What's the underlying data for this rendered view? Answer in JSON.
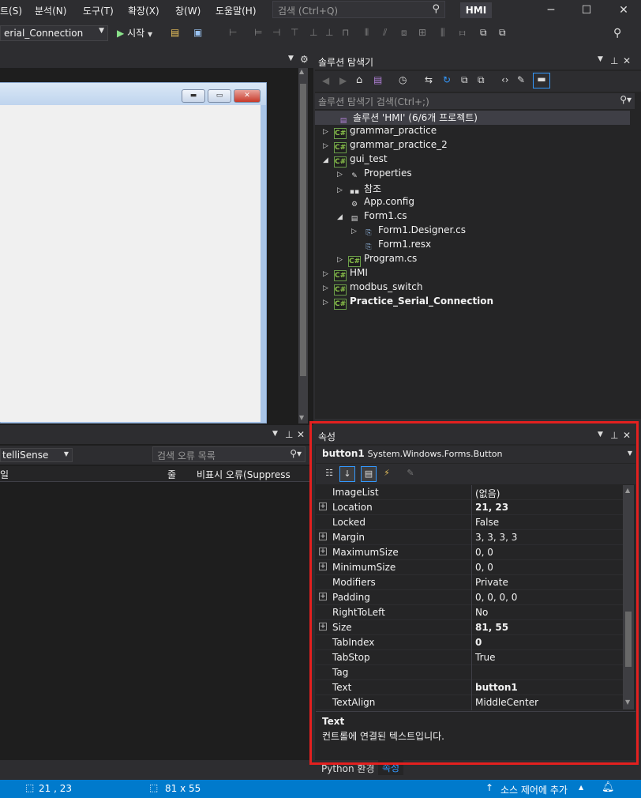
{
  "menubar": {
    "items": [
      "트(S)",
      "분석(N)",
      "도구(T)",
      "확장(X)",
      "창(W)",
      "도움말(H)"
    ],
    "search_placeholder": "검색 (Ctrl+Q)",
    "solution_name": "HMI"
  },
  "toolbar": {
    "project_combo": "erial_Connection",
    "start_label": "시작"
  },
  "solution_explorer": {
    "title": "솔루션 탐색기",
    "search_placeholder": "솔루션 탐색기 검색(Ctrl+;)",
    "items": [
      {
        "label": "솔루션 'HMI' (6/6개 프로젝트)",
        "indent": 0,
        "arrow": "",
        "icon": "solution"
      },
      {
        "label": "grammar_practice",
        "indent": 0,
        "arrow": "▷",
        "icon": "C#"
      },
      {
        "label": "grammar_practice_2",
        "indent": 0,
        "arrow": "▷",
        "icon": "C#"
      },
      {
        "label": "gui_test",
        "indent": 0,
        "arrow": "◢",
        "icon": "C#"
      },
      {
        "label": "Properties",
        "indent": 1,
        "arrow": "▷",
        "icon": "wrench"
      },
      {
        "label": "참조",
        "indent": 1,
        "arrow": "▷",
        "icon": "ref"
      },
      {
        "label": "App.config",
        "indent": 1,
        "arrow": "",
        "icon": "config"
      },
      {
        "label": "Form1.cs",
        "indent": 1,
        "arrow": "◢",
        "icon": "form"
      },
      {
        "label": "Form1.Designer.cs",
        "indent": 2,
        "arrow": "▷",
        "icon": "file"
      },
      {
        "label": "Form1.resx",
        "indent": 2,
        "arrow": "",
        "icon": "file"
      },
      {
        "label": "Program.cs",
        "indent": 1,
        "arrow": "▷",
        "icon": "C#"
      },
      {
        "label": "HMI",
        "indent": 0,
        "arrow": "▷",
        "icon": "C#"
      },
      {
        "label": "modbus_switch",
        "indent": 0,
        "arrow": "▷",
        "icon": "C#"
      },
      {
        "label": "Practice_Serial_Connection",
        "indent": 0,
        "arrow": "▷",
        "icon": "C#",
        "bold": true
      }
    ]
  },
  "error_list": {
    "combo": "telliSense",
    "search_placeholder": "검색 오류 목록",
    "columns": [
      "일",
      "줄",
      "비표시 오류(Suppress"
    ]
  },
  "properties": {
    "title": "속성",
    "object_name": "button1",
    "object_type": "System.Windows.Forms.Button",
    "rows": [
      {
        "name": "ImageList",
        "value": "(없음)",
        "expand": false,
        "bold": false
      },
      {
        "name": "Location",
        "value": "21, 23",
        "expand": true,
        "bold": true
      },
      {
        "name": "Locked",
        "value": "False",
        "expand": false,
        "bold": false
      },
      {
        "name": "Margin",
        "value": "3, 3, 3, 3",
        "expand": true,
        "bold": false
      },
      {
        "name": "MaximumSize",
        "value": "0, 0",
        "expand": true,
        "bold": false
      },
      {
        "name": "MinimumSize",
        "value": "0, 0",
        "expand": true,
        "bold": false
      },
      {
        "name": "Modifiers",
        "value": "Private",
        "expand": false,
        "bold": false
      },
      {
        "name": "Padding",
        "value": "0, 0, 0, 0",
        "expand": true,
        "bold": false
      },
      {
        "name": "RightToLeft",
        "value": "No",
        "expand": false,
        "bold": false
      },
      {
        "name": "Size",
        "value": "81, 55",
        "expand": true,
        "bold": true
      },
      {
        "name": "TabIndex",
        "value": "0",
        "expand": false,
        "bold": true
      },
      {
        "name": "TabStop",
        "value": "True",
        "expand": false,
        "bold": false
      },
      {
        "name": "Tag",
        "value": "",
        "expand": false,
        "bold": false
      },
      {
        "name": "Text",
        "value": "button1",
        "expand": false,
        "bold": true
      },
      {
        "name": "TextAlign",
        "value": "MiddleCenter",
        "expand": false,
        "bold": false
      }
    ],
    "desc_title": "Text",
    "desc_text": "컨트롤에 연결된 텍스트입니다."
  },
  "bottom_tabs": [
    "Python 환경",
    "속성"
  ],
  "statusbar": {
    "position": "21 , 23",
    "size": "81 x 55",
    "source_control": "소스 제어에 추가"
  },
  "colors": {
    "accent": "#007acc",
    "highlight_box": "#e3201f"
  }
}
